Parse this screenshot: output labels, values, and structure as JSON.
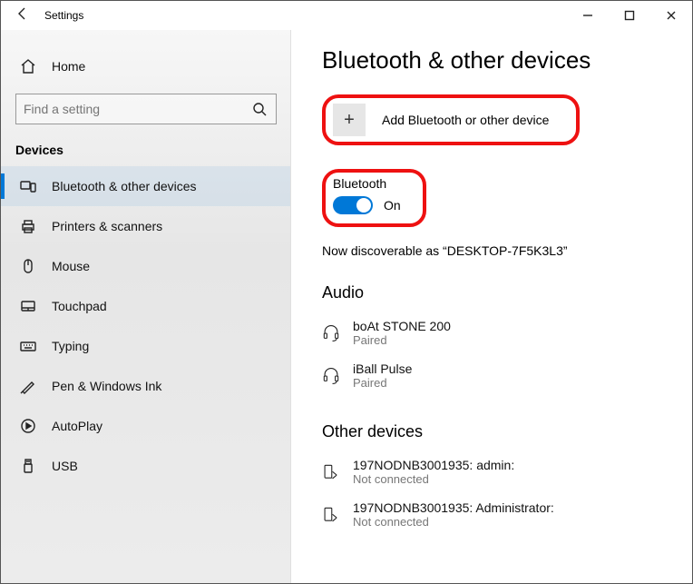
{
  "window": {
    "title": "Settings"
  },
  "sidebar": {
    "home": "Home",
    "search_placeholder": "Find a setting",
    "group": "Devices",
    "items": [
      {
        "label": "Bluetooth & other devices"
      },
      {
        "label": "Printers & scanners"
      },
      {
        "label": "Mouse"
      },
      {
        "label": "Touchpad"
      },
      {
        "label": "Typing"
      },
      {
        "label": "Pen & Windows Ink"
      },
      {
        "label": "AutoPlay"
      },
      {
        "label": "USB"
      }
    ]
  },
  "main": {
    "heading": "Bluetooth & other devices",
    "add_label": "Add Bluetooth or other device",
    "bluetooth_label": "Bluetooth",
    "bluetooth_state": "On",
    "discoverable": "Now discoverable as “DESKTOP-7F5K3L3”",
    "audio_header": "Audio",
    "audio_devices": [
      {
        "name": "boAt STONE 200",
        "status": "Paired"
      },
      {
        "name": "iBall Pulse",
        "status": "Paired"
      }
    ],
    "other_header": "Other devices",
    "other_devices": [
      {
        "name": "197NODNB3001935: admin:",
        "status": "Not connected"
      },
      {
        "name": "197NODNB3001935: Administrator:",
        "status": "Not connected"
      }
    ]
  }
}
